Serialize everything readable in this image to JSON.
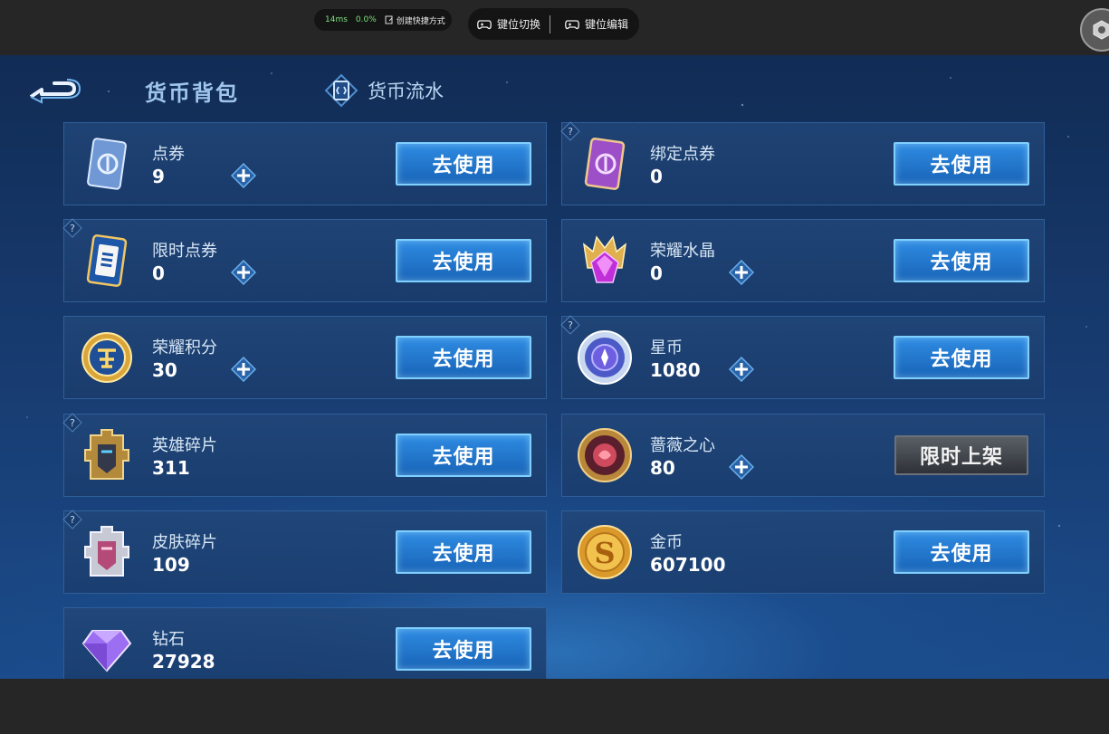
{
  "overlay": {
    "latency": "14ms",
    "loss": "0.0%",
    "shortcut_label": "创建快捷方式",
    "key_switch_label": "键位切换",
    "key_edit_label": "键位编辑"
  },
  "header": {
    "title": "货币背包",
    "flow_tab_label": "货币流水"
  },
  "cards": [
    {
      "name": "点券",
      "value": "9",
      "button": "去使用",
      "icon": "coupon-card-icon",
      "has_plus": true,
      "has_help": false
    },
    {
      "name": "绑定点券",
      "value": "0",
      "button": "去使用",
      "icon": "bound-coupon-card-icon",
      "has_plus": false,
      "has_help": true
    },
    {
      "name": "限时点券",
      "value": "0",
      "button": "去使用",
      "icon": "limited-coupon-card-icon",
      "has_plus": true,
      "has_help": true
    },
    {
      "name": "荣耀水晶",
      "value": "0",
      "button": "去使用",
      "icon": "glory-crystal-icon",
      "has_plus": true,
      "has_help": false
    },
    {
      "name": "荣耀积分",
      "value": "30",
      "button": "去使用",
      "icon": "glory-points-coin-icon",
      "has_plus": true,
      "has_help": false
    },
    {
      "name": "星币",
      "value": "1080",
      "button": "去使用",
      "icon": "star-coin-icon",
      "has_plus": true,
      "has_help": true
    },
    {
      "name": "英雄碎片",
      "value": "311",
      "button": "去使用",
      "icon": "hero-fragment-icon",
      "has_plus": false,
      "has_help": true
    },
    {
      "name": "蔷薇之心",
      "value": "80",
      "button": "限时上架",
      "icon": "rose-heart-icon",
      "has_plus": true,
      "has_help": false,
      "button_disabled": true
    },
    {
      "name": "皮肤碎片",
      "value": "109",
      "button": "去使用",
      "icon": "skin-fragment-icon",
      "has_plus": false,
      "has_help": true
    },
    {
      "name": "金币",
      "value": "607100",
      "button": "去使用",
      "icon": "gold-coin-icon",
      "has_plus": false,
      "has_help": false
    },
    {
      "name": "钻石",
      "value": "27928",
      "button": "去使用",
      "icon": "diamond-icon",
      "has_plus": false,
      "has_help": false
    }
  ]
}
